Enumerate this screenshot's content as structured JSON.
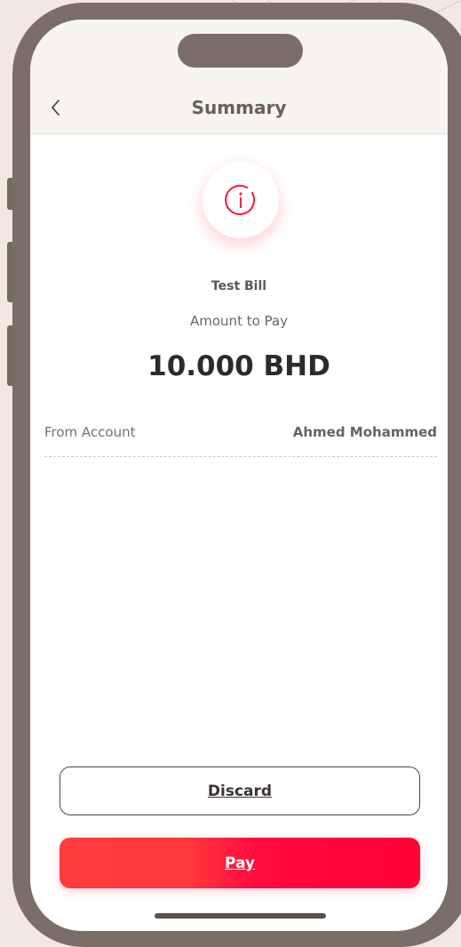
{
  "header": {
    "title": "Summary",
    "back_icon": "chevron-left-icon"
  },
  "summary": {
    "status_icon": "info-icon",
    "bill_name": "Test Bill",
    "amount_label": "Amount to Pay",
    "amount": "10.000 BHD"
  },
  "details": [
    {
      "label": "From Account",
      "value": "Ahmed Mohammed"
    }
  ],
  "actions": {
    "discard_label": "Discard",
    "pay_label": "Pay"
  },
  "colors": {
    "accent": "#ff0a3f",
    "frame": "#7a6e66",
    "background": "#f1e9df"
  }
}
